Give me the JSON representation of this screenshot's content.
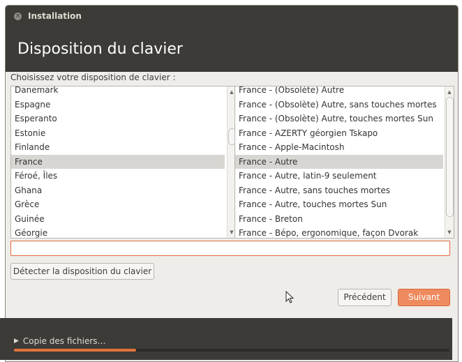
{
  "window": {
    "title": "Installation"
  },
  "header": {
    "title": "Disposition du clavier"
  },
  "prompt": "Choisissez votre disposition de clavier :",
  "layouts": {
    "items": [
      "Danemark",
      "Espagne",
      "Esperanto",
      "Estonie",
      "Finlande",
      "France",
      "Féroé, Îles",
      "Ghana",
      "Grèce",
      "Guinée",
      "Géorgie"
    ],
    "selected": "France"
  },
  "variants": {
    "items": [
      "France - (Obsolète) Autre",
      "France - (Obsolète) Autre, sans touches mortes",
      "France - (Obsolète) Autre, touches mortes Sun",
      "France - AZERTY géorgien Tskapo",
      "France - Apple-Macintosh",
      "France - Autre",
      "France - Autre, latin-9 seulement",
      "France - Autre, sans touches mortes",
      "France - Autre, touches mortes Sun",
      "France - Breton",
      "France - Bépo, ergonomique, façon Dvorak"
    ],
    "selected": "France - Autre"
  },
  "test_input": {
    "value": "",
    "placeholder": ""
  },
  "buttons": {
    "detect": "Détecter la disposition du clavier",
    "previous": "Précédent",
    "next": "Suivant"
  },
  "progress": {
    "label": "Copie des fichiers…",
    "fraction": 0.28
  },
  "colors": {
    "accent": "#e1733c",
    "next_button": "#ee8a5e",
    "dark_bar": "#3c3b37",
    "selection": "#d8d6d2"
  }
}
